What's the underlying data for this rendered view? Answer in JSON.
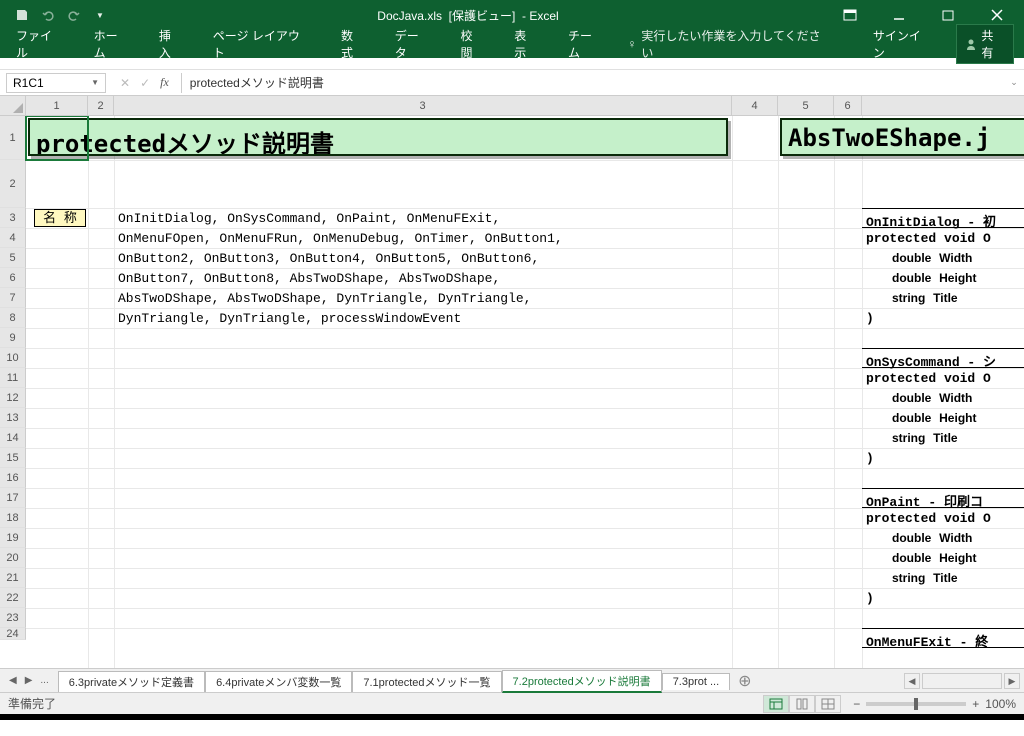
{
  "title": {
    "doc": "DocJava.xls",
    "mode": "[保護ビュー]",
    "app": "- Excel"
  },
  "ribbon": {
    "file": "ファイル",
    "home": "ホーム",
    "insert": "挿入",
    "page": "ページ レイアウト",
    "formula": "数式",
    "data": "データ",
    "review": "校閲",
    "view": "表示",
    "team": "チーム",
    "tell": "実行したい作業を入力してください",
    "signin": "サインイン",
    "share": "共有"
  },
  "namebox": "R1C1",
  "formula": "protectedメソッド説明書",
  "cols": {
    "c1": "1",
    "c2": "2",
    "c3": "3",
    "c4": "4",
    "c5": "5",
    "c6": "6"
  },
  "header1": "protectedメソッド説明書",
  "header2": "AbsTwoEShape.j",
  "label_name": "名 称",
  "method_lines": [
    "OnInitDialog, OnSysCommand, OnPaint, OnMenuFExit,",
    "OnMenuFOpen, OnMenuFRun, OnMenuDebug, OnTimer, OnButton1,",
    "OnButton2, OnButton3, OnButton4, OnButton5, OnButton6,",
    "OnButton7, OnButton8, AbsTwoDShape, AbsTwoDShape,",
    "AbsTwoDShape, AbsTwoDShape, DynTriangle, DynTriangle,",
    "DynTriangle, DynTriangle, processWindowEvent"
  ],
  "blocks": [
    {
      "title": "OnInitDialog - 初",
      "proto": "protected void O",
      "p1": "double",
      "p1i": "Width",
      "p2": "double",
      "p2i": "Height",
      "p3": "string",
      "p3i": "Title",
      "end": ")"
    },
    {
      "title": "OnSysCommand - シ",
      "proto": "protected void O",
      "p1": "double",
      "p1i": "Width",
      "p2": "double",
      "p2i": "Height",
      "p3": "string",
      "p3i": "Title",
      "end": ")"
    },
    {
      "title": "OnPaint  - 印刷コ",
      "proto": "protected void O",
      "p1": "double",
      "p1i": "Width",
      "p2": "double",
      "p2i": "Height",
      "p3": "string",
      "p3i": "Title",
      "end": ")"
    },
    {
      "title": "OnMenuFExit - 終"
    }
  ],
  "sheets": {
    "more": "...",
    "s1": "6.3privateメソッド定義書",
    "s2": "6.4privateメンバ変数一覧",
    "s3": "7.1protectedメソッド一覧",
    "s4": "7.2protectedメソッド説明書",
    "s5": "7.3prot ..."
  },
  "status": {
    "ready": "準備完了",
    "zoom": "100%"
  },
  "colors": {
    "excel_green": "#0e6030",
    "cell_green": "#c5f0ca",
    "cell_yellow": "#fff8c0"
  }
}
